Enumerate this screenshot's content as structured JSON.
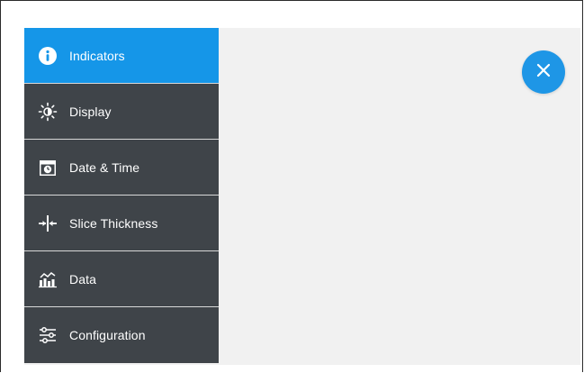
{
  "menu": {
    "items": [
      {
        "label": "Indicators",
        "icon": "info-icon",
        "active": true
      },
      {
        "label": "Display",
        "icon": "brightness-icon",
        "active": false
      },
      {
        "label": "Date & Time",
        "icon": "calendar-clock-icon",
        "active": false
      },
      {
        "label": "Slice Thickness",
        "icon": "slice-thickness-icon",
        "active": false
      },
      {
        "label": "Data",
        "icon": "data-chart-icon",
        "active": false
      },
      {
        "label": "Configuration",
        "icon": "sliders-icon",
        "active": false
      }
    ]
  },
  "close": {
    "icon": "close-icon"
  },
  "colors": {
    "accent": "#1596e8",
    "sidebar_bg": "#3f4449",
    "content_bg": "#f1f1f1",
    "divider": "#d8d8d8"
  }
}
